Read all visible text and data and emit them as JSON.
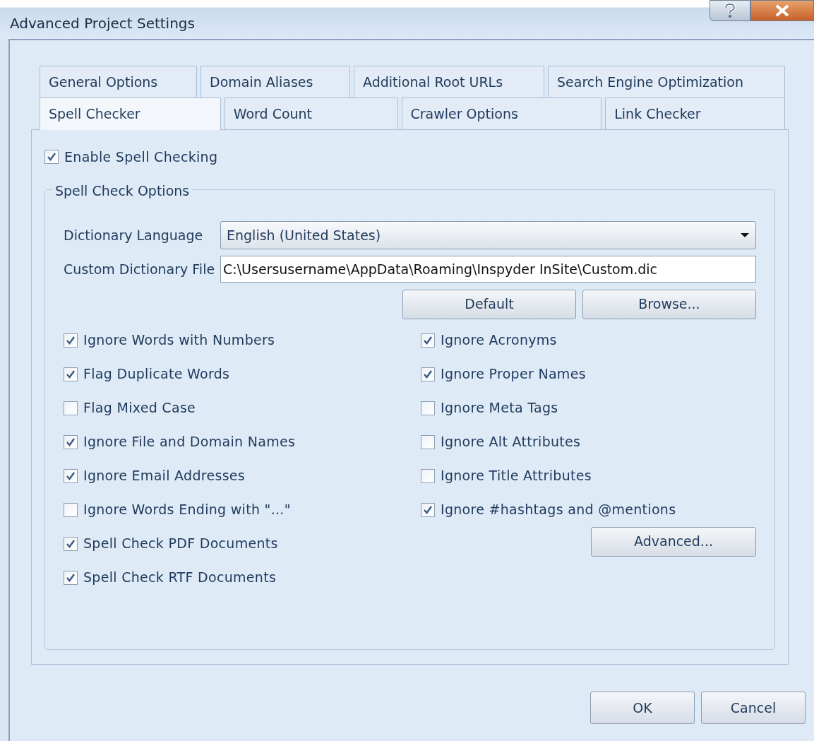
{
  "window": {
    "title": "Advanced Project Settings"
  },
  "tab_rows": [
    [
      {
        "label": "General Options",
        "selected": false
      },
      {
        "label": "Domain Aliases",
        "selected": false
      },
      {
        "label": "Additional Root URLs",
        "selected": false
      },
      {
        "label": "Search Engine Optimization",
        "selected": false
      }
    ],
    [
      {
        "label": "Spell Checker",
        "selected": true
      },
      {
        "label": "Word Count",
        "selected": false
      },
      {
        "label": "Crawler Options",
        "selected": false
      },
      {
        "label": "Link Checker",
        "selected": false
      }
    ]
  ],
  "enable": {
    "label": "Enable Spell Checking",
    "checked": true
  },
  "group": {
    "title": "Spell Check Options",
    "language": {
      "label": "Dictionary Language",
      "value": "English (United States)"
    },
    "custom_file": {
      "label": "Custom Dictionary File",
      "value": "C:\\Usersusername\\AppData\\Roaming\\Inspyder InSite\\Custom.dic"
    },
    "file_buttons": [
      "Default",
      "Browse..."
    ],
    "left_options": [
      {
        "label": "Ignore Words with Numbers",
        "checked": true
      },
      {
        "label": "Flag Duplicate Words",
        "checked": true
      },
      {
        "label": "Flag Mixed Case",
        "checked": false
      },
      {
        "label": "Ignore File and Domain Names",
        "checked": true
      },
      {
        "label": "Ignore Email Addresses",
        "checked": true
      },
      {
        "label": "Ignore Words Ending with \"...\"",
        "checked": false
      },
      {
        "label": "Spell Check PDF Documents",
        "checked": true
      },
      {
        "label": "Spell Check RTF Documents",
        "checked": true
      }
    ],
    "right_options": [
      {
        "label": "Ignore Acronyms",
        "checked": true
      },
      {
        "label": "Ignore Proper Names",
        "checked": true
      },
      {
        "label": "Ignore Meta Tags",
        "checked": false
      },
      {
        "label": "Ignore Alt Attributes",
        "checked": false
      },
      {
        "label": "Ignore Title Attributes",
        "checked": false
      },
      {
        "label": "Ignore #hashtags and @mentions",
        "checked": true
      }
    ],
    "advanced_button": "Advanced..."
  },
  "buttons": [
    "OK",
    "Cancel"
  ]
}
